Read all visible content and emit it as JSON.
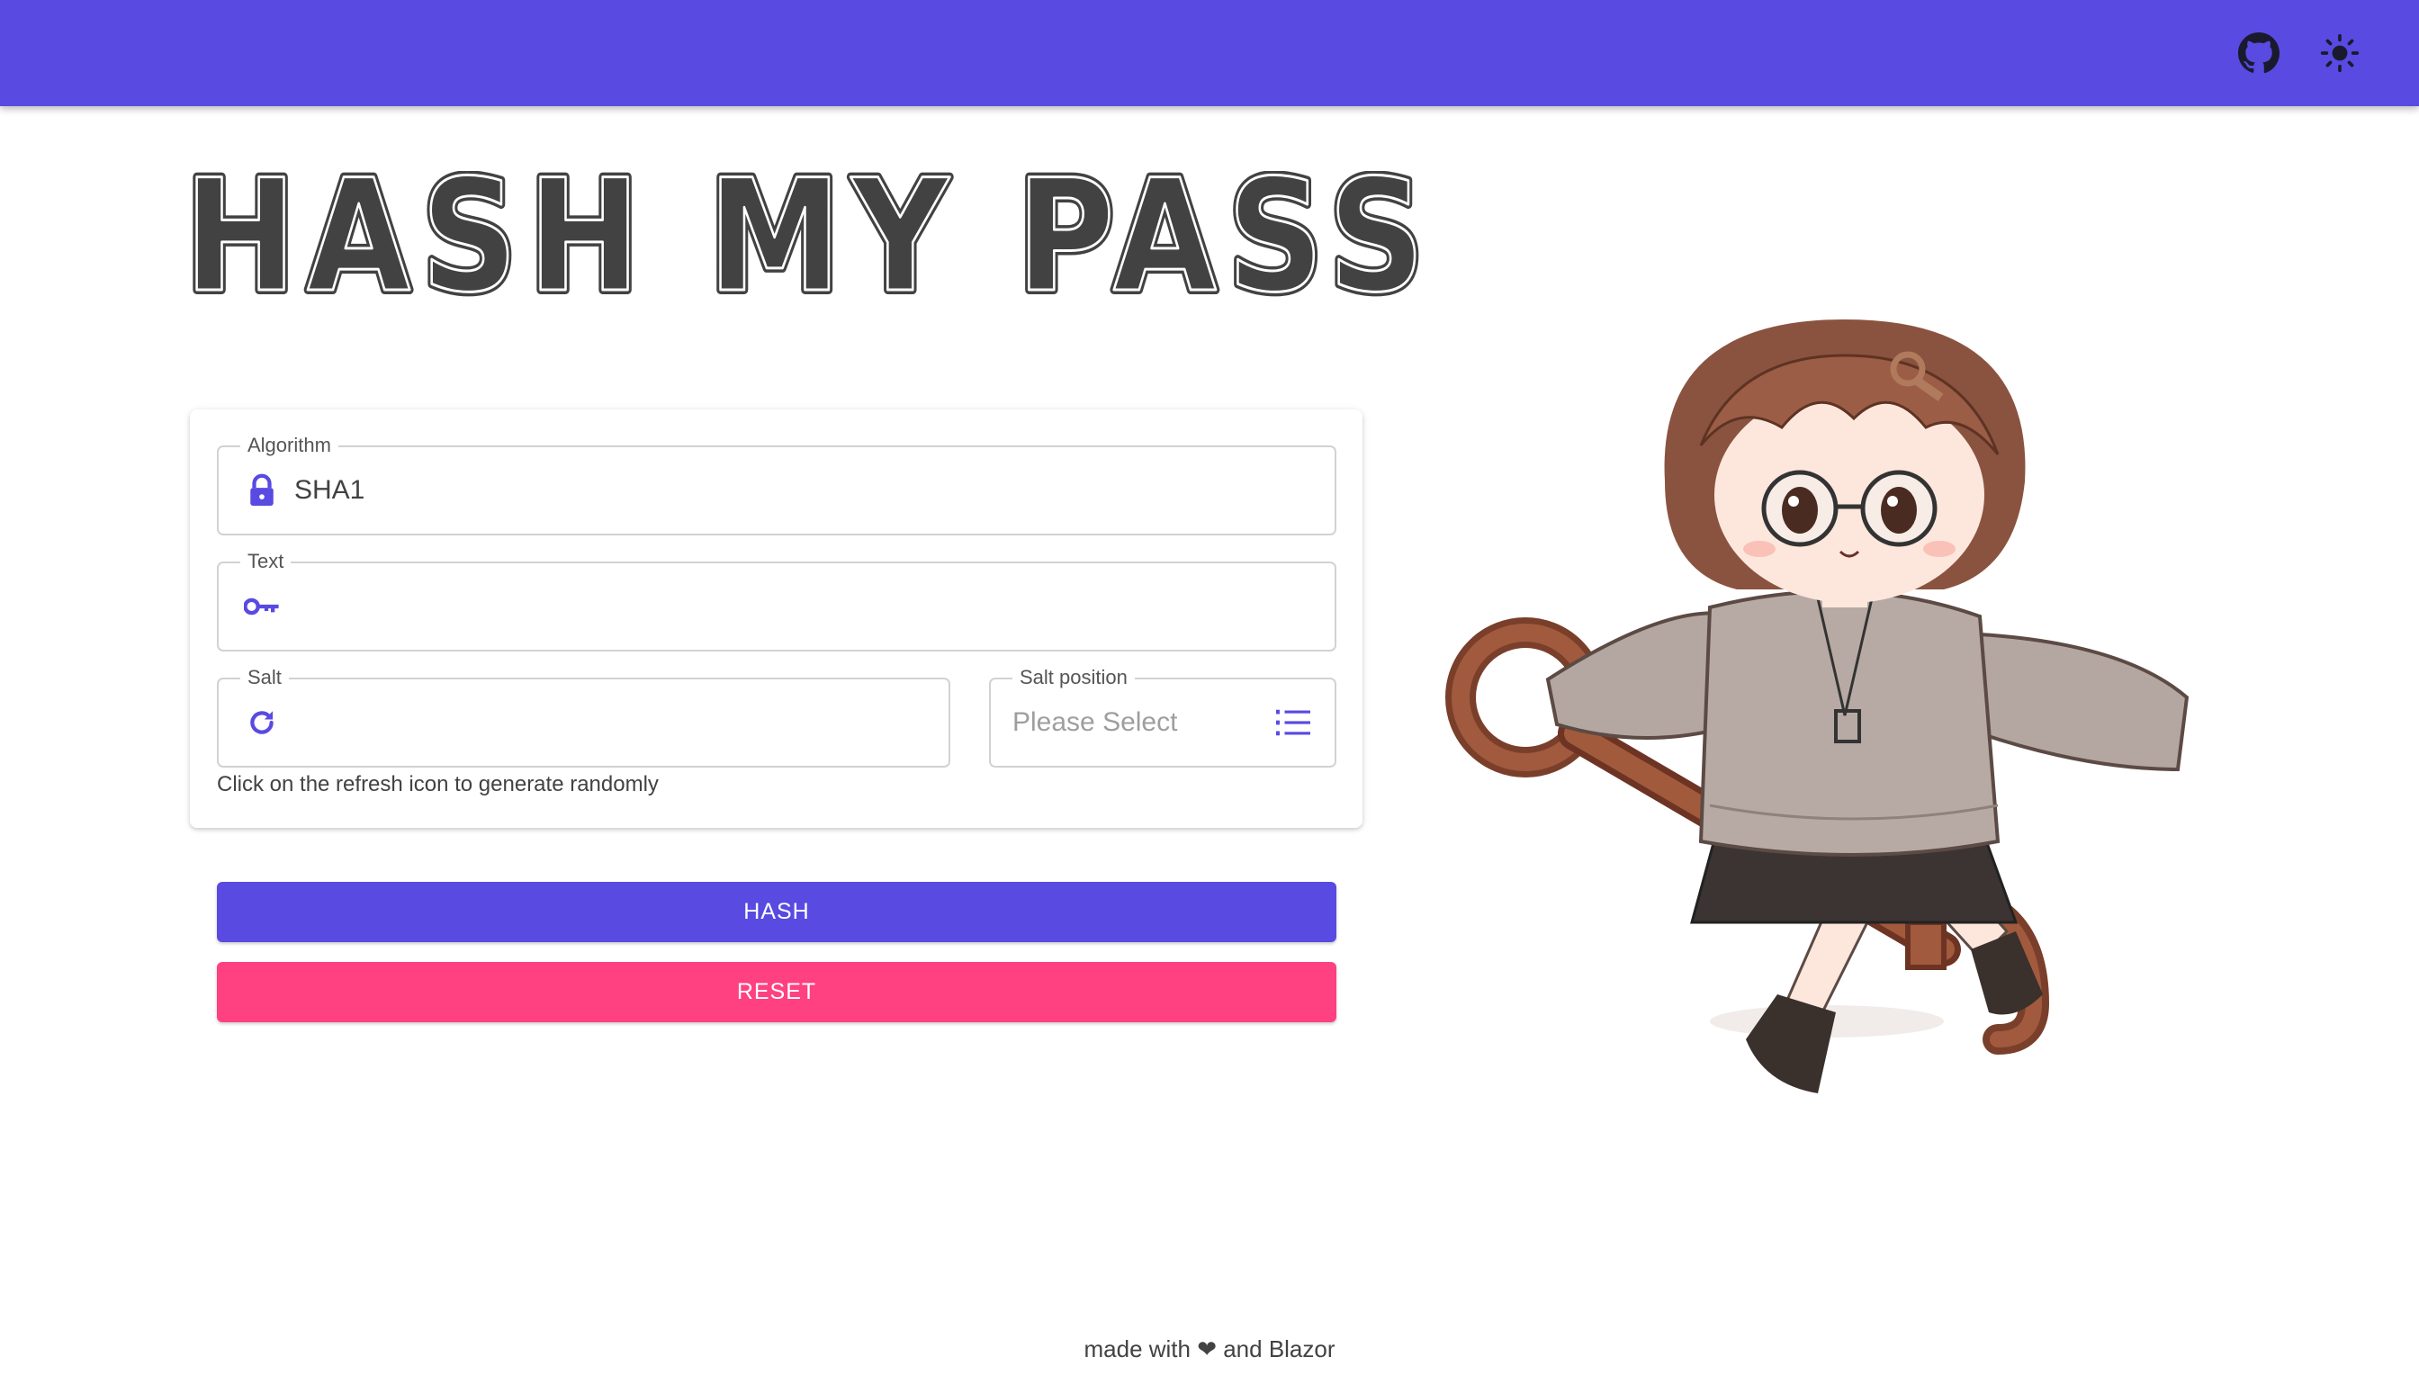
{
  "header": {
    "github_icon": "github-icon",
    "theme_icon": "sun-icon",
    "background_color": "#594ae2"
  },
  "logo": {
    "title": "HASH MY PASS"
  },
  "form": {
    "algorithm": {
      "label": "Algorithm",
      "value": "SHA1",
      "icon": "lock-icon"
    },
    "text": {
      "label": "Text",
      "value": "",
      "icon": "key-icon"
    },
    "salt": {
      "label": "Salt",
      "value": "",
      "icon": "refresh-icon"
    },
    "salt_position": {
      "label": "Salt position",
      "placeholder": "Please Select",
      "icon": "list-icon"
    },
    "helper_text": "Click on the refresh icon to generate randomly"
  },
  "actions": {
    "hash_label": "HASH",
    "reset_label": "RESET",
    "hash_color": "#594ae2",
    "reset_color": "#ff4081"
  },
  "illustration": {
    "description_icon": "chibi-girl-with-key-illustration"
  },
  "footer": {
    "text": "made with ❤ and Blazor"
  }
}
